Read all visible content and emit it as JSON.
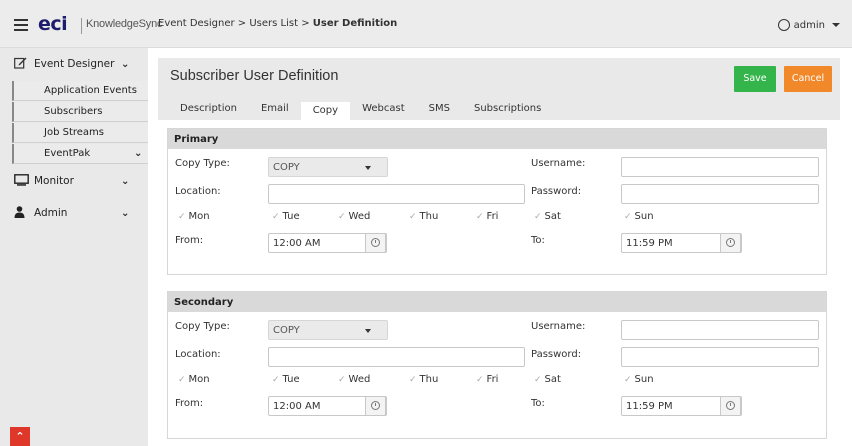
{
  "topbar": {
    "logo": "eci",
    "logo_sub": "KnowledgeSync",
    "breadcrumb_part1": "Event Designer > Users List > ",
    "breadcrumb_current": "User Definition",
    "user": "admin"
  },
  "sidebar": {
    "event_designer": "Event Designer",
    "sub_items": [
      "Application Events",
      "Subscribers",
      "Job Streams",
      "EventPak"
    ],
    "monitor": "Monitor",
    "admin": "Admin"
  },
  "main": {
    "title": "Subscriber User Definition",
    "save_label": "Save",
    "cancel_label": "Cancel",
    "tabs": [
      "Description",
      "Email",
      "Copy",
      "Webcast",
      "SMS",
      "Subscriptions"
    ],
    "active_tab": "Copy"
  },
  "primary": {
    "title": "Primary",
    "copy_type_label": "Copy Type:",
    "copy_type_value": "COPY",
    "location_label": "Location:",
    "location_value": "",
    "username_label": "Username:",
    "username_value": "",
    "password_label": "Password:",
    "password_value": "",
    "days": [
      "Mon",
      "Tue",
      "Wed",
      "Thu",
      "Fri",
      "Sat",
      "Sun"
    ],
    "from_label": "From:",
    "from_value": "12:00 AM",
    "to_label": "To:",
    "to_value": "11:59 PM"
  },
  "secondary": {
    "title": "Secondary",
    "copy_type_label": "Copy Type:",
    "copy_type_value": "COPY",
    "location_label": "Location:",
    "location_value": "",
    "username_label": "Username:",
    "username_value": "",
    "password_label": "Password:",
    "password_value": "",
    "days": [
      "Mon",
      "Tue",
      "Wed",
      "Thu",
      "Fri",
      "Sat",
      "Sun"
    ],
    "from_label": "From:",
    "from_value": "12:00 AM",
    "to_label": "To:",
    "to_value": "11:59 PM"
  }
}
